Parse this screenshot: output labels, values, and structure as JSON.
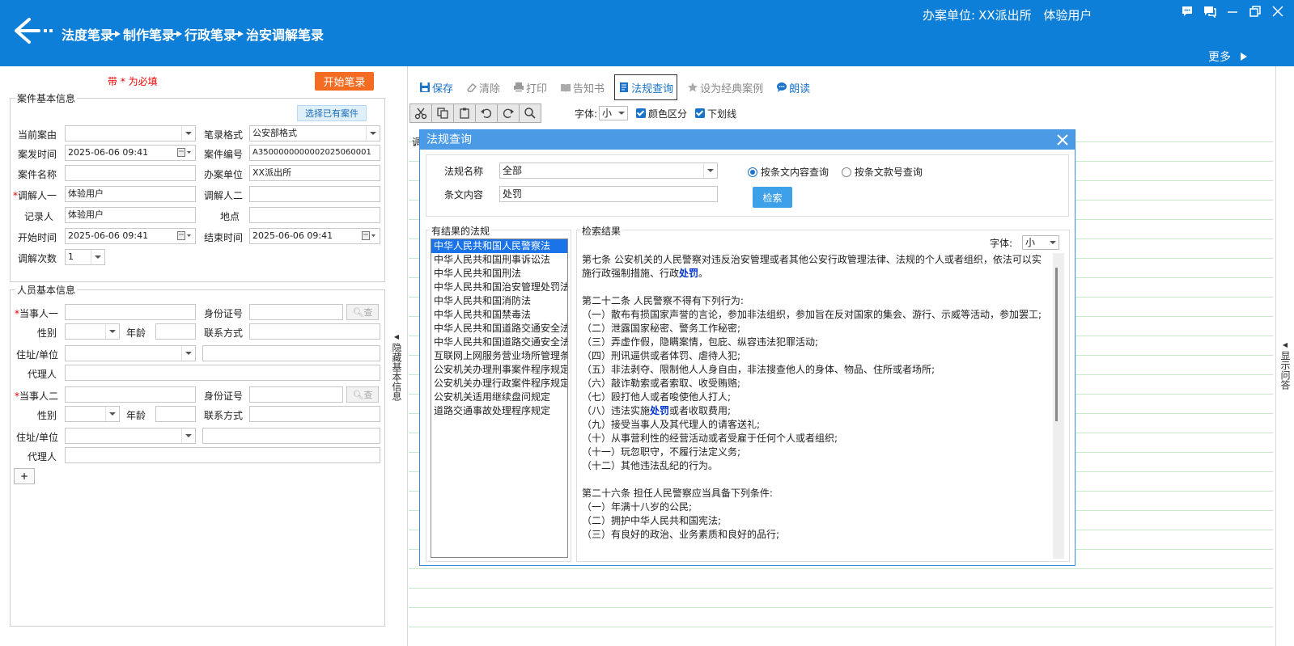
{
  "header": {
    "breadcrumb": [
      "法度笔录",
      "制作笔录",
      "行政笔录",
      "治安调解笔录"
    ],
    "office_label": "办案单位:",
    "office_name": "XX派出所",
    "user": "体验用户",
    "more": "更多"
  },
  "left": {
    "required_note": "带 * 为必填",
    "start_button": "开始笔录",
    "case_group_title": "案件基本信息",
    "pick_case_button": "选择已有案件",
    "fields": {
      "cause_label": "当前案由",
      "cause_value": "",
      "format_label": "笔录格式",
      "format_value": "公安部格式",
      "occur_time_label": "案发时间",
      "occur_time_value": "2025-06-06 09:41",
      "case_no_label": "案件编号",
      "case_no_value": "A3500000000002025060001",
      "case_name_label": "案件名称",
      "case_name_value": "",
      "unit_label": "办案单位",
      "unit_value": "XX派出所",
      "mediator1_label": "调解人一",
      "mediator1_value": "体验用户",
      "mediator2_label": "调解人二",
      "mediator2_value": "",
      "recorder_label": "记录人",
      "recorder_value": "体验用户",
      "place_label": "地点",
      "place_value": "",
      "start_time_label": "开始时间",
      "start_time_value": "2025-06-06 09:41",
      "end_time_label": "结束时间",
      "end_time_value": "2025-06-06 09:41",
      "count_label": "调解次数",
      "count_value": "1"
    },
    "person_group_title": "人员基本信息",
    "persons": [
      {
        "party_label": "当事人一",
        "id_label": "身份证号",
        "query": "查",
        "gender_label": "性别",
        "age_label": "年龄",
        "contact_label": "联系方式",
        "address_label": "住址/单位",
        "agent_label": "代理人"
      },
      {
        "party_label": "当事人二",
        "id_label": "身份证号",
        "query": "查",
        "gender_label": "性别",
        "age_label": "年龄",
        "contact_label": "联系方式",
        "address_label": "住址/单位",
        "agent_label": "代理人"
      }
    ],
    "add_button": "+",
    "collapse_label": "隐藏基本信息"
  },
  "right_collapse_label": "显示问答",
  "toolbar": {
    "save": "保存",
    "clear": "清除",
    "print": "打印",
    "notice": "告知书",
    "law_query": "法规查询",
    "set_classic": "设为经典案例",
    "read_aloud": "朗读"
  },
  "editbar": {
    "font_label": "字体:",
    "font_value": "小",
    "color_label": "颜色区分",
    "underline_label": "下划线"
  },
  "doc_first_char": "调",
  "dialog": {
    "title": "法规查询",
    "law_name_label": "法规名称",
    "law_name_value": "全部",
    "article_label": "条文内容",
    "article_value": "处罚",
    "radio_content": "按条文内容查询",
    "radio_number": "按条文款号查询",
    "search_button": "检索",
    "laws_title": "有结果的法规",
    "laws": [
      "中华人民共和国人民警察法",
      "中华人民共和国刑事诉讼法",
      "中华人民共和国刑法",
      "中华人民共和国治安管理处罚法",
      "中华人民共和国消防法",
      "中华人民共和国禁毒法",
      "中华人民共和国道路交通安全法",
      "中华人民共和国道路交通安全法",
      "互联网上网服务营业场所管理条",
      "公安机关办理刑事案件程序规定",
      "公安机关办理行政案件程序规定",
      "公安机关适用继续盘问规定",
      "道路交通事故处理程序规定"
    ],
    "results_title": "检索结果",
    "results_font_label": "字体:",
    "results_font_value": "小",
    "results": {
      "a7_pre": "第七条   公安机关的人民警察对违反治安管理或者其他公安行政管理法律、法规的个人或者组织，依法可以实施行政强制措施、行政",
      "a7_hl": "处罚",
      "a7_post": "。",
      "a22_title": "第二十二条   人民警察不得有下列行为:",
      "a22_1": "（一）散布有损国家声誉的言论，参加非法组织，参加旨在反对国家的集会、游行、示威等活动，参加罢工;",
      "a22_2": "（二）泄露国家秘密、警务工作秘密;",
      "a22_3": "（三）弄虚作假，隐瞒案情，包庇、纵容违法犯罪活动;",
      "a22_4": "（四）刑讯逼供或者体罚、虐待人犯;",
      "a22_5": "（五）非法剥夺、限制他人人身自由，非法搜查他人的身体、物品、住所或者场所;",
      "a22_6": "（六）敲诈勒索或者索取、收受贿赂;",
      "a22_7": "（七）殴打他人或者唆使他人打人;",
      "a22_8_pre": "（八）违法实施",
      "a22_8_hl": "处罚",
      "a22_8_post": "或者收取费用;",
      "a22_9": "（九）接受当事人及其代理人的请客送礼;",
      "a22_10": "（十）从事营利性的经营活动或者受雇于任何个人或者组织;",
      "a22_11": "（十一）玩忽职守，不履行法定义务;",
      "a22_12": "（十二）其他违法乱纪的行为。",
      "a26_title": "第二十六条   担任人民警察应当具备下列条件:",
      "a26_1": "（一）年满十八岁的公民;",
      "a26_2": "（二）拥护中华人民共和国宪法;",
      "a26_3": "（三）有良好的政治、业务素质和良好的品行;"
    }
  },
  "colors": {
    "header": "#0d7fd8",
    "accent": "#1a73c8",
    "start_button": "#f36c22",
    "dialog_title": "#4a9ae6"
  }
}
